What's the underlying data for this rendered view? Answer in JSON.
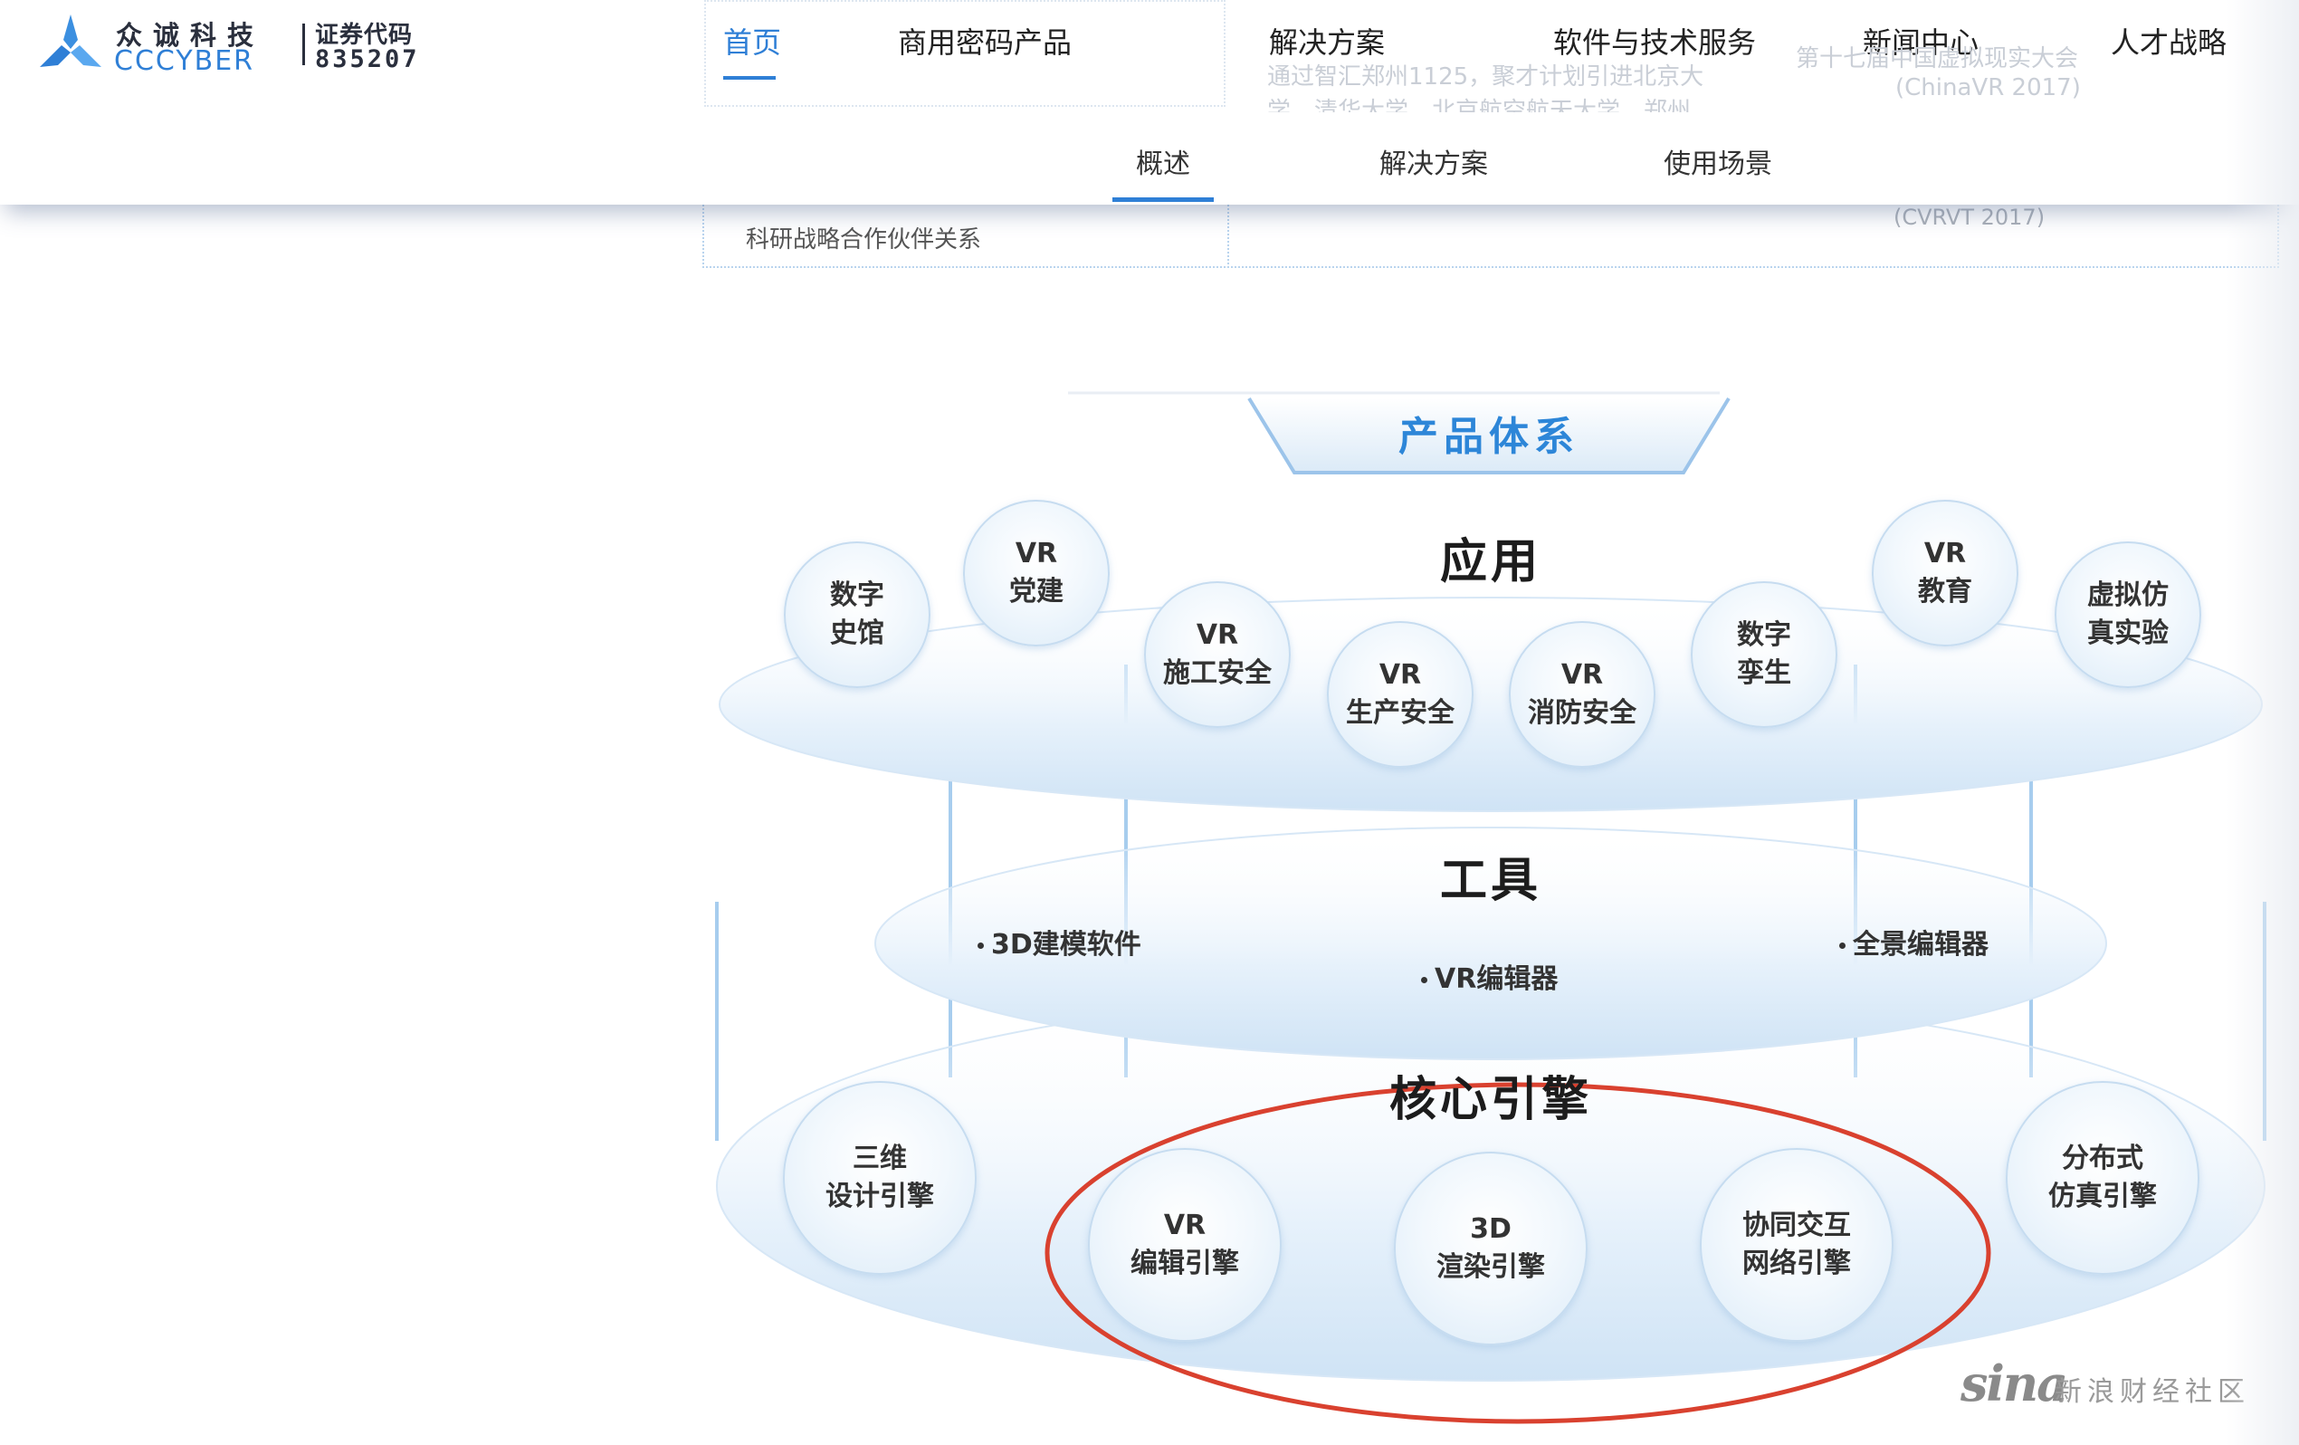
{
  "logo": {
    "name_cn": "众诚科技",
    "name_en": "CCCYBER",
    "stock_label": "证券代码",
    "stock_code": "835207"
  },
  "nav": {
    "items": [
      {
        "label": "首页",
        "active": true
      },
      {
        "label": "商用密码产品"
      },
      {
        "label": "解决方案"
      },
      {
        "label": "软件与技术服务"
      },
      {
        "label": "新闻中心"
      },
      {
        "label": "人才战略"
      }
    ]
  },
  "subnav": {
    "items": [
      {
        "label": "概述",
        "active": true
      },
      {
        "label": "解决方案"
      },
      {
        "label": "使用场景"
      }
    ]
  },
  "background": {
    "ghost_line1": "通过智汇郑州1125，聚才计划引进北京大",
    "ghost_line2": "学、清华大学、北京航空航天大学、郑州",
    "ghost_right1": "第十七届中国虚拟现实大会",
    "ghost_right2": "(ChinaVR 2017)",
    "visible_text": "科研战略合作伙伴关系",
    "faded_right": "(CVRVT 2017)"
  },
  "diagram": {
    "title": "产品体系",
    "layers": {
      "application": {
        "title": "应用",
        "nodes": [
          {
            "line1": "数字",
            "line2": "史馆"
          },
          {
            "line1": "VR",
            "line2": "党建"
          },
          {
            "line1": "VR",
            "line2": "施工安全"
          },
          {
            "line1": "VR",
            "line2": "生产安全"
          },
          {
            "line1": "VR",
            "line2": "消防安全"
          },
          {
            "line1": "数字",
            "line2": "孪生"
          },
          {
            "line1": "VR",
            "line2": "教育"
          },
          {
            "line1": "虚拟仿",
            "line2": "真实验"
          }
        ]
      },
      "tools": {
        "title": "工具",
        "items": [
          "3D建模软件",
          "VR编辑器",
          "全景编辑器"
        ]
      },
      "core": {
        "title": "核心引擎",
        "nodes": [
          {
            "line1": "三维",
            "line2": "设计引擎"
          },
          {
            "line1": "VR",
            "line2": "编辑引擎"
          },
          {
            "line1": "3D",
            "line2": "渲染引擎"
          },
          {
            "line1": "协同交互",
            "line2": "网络引擎"
          },
          {
            "line1": "分布式",
            "line2": "仿真引擎"
          }
        ]
      }
    }
  },
  "annotation": {
    "color": "#d9412f",
    "shape": "ellipse"
  },
  "watermark": {
    "logo": "sina",
    "text": "新浪财经社区"
  },
  "colors": {
    "accent": "#2f7fd6",
    "node_border": "#c6dcf0",
    "annotation": "#d9412f"
  }
}
